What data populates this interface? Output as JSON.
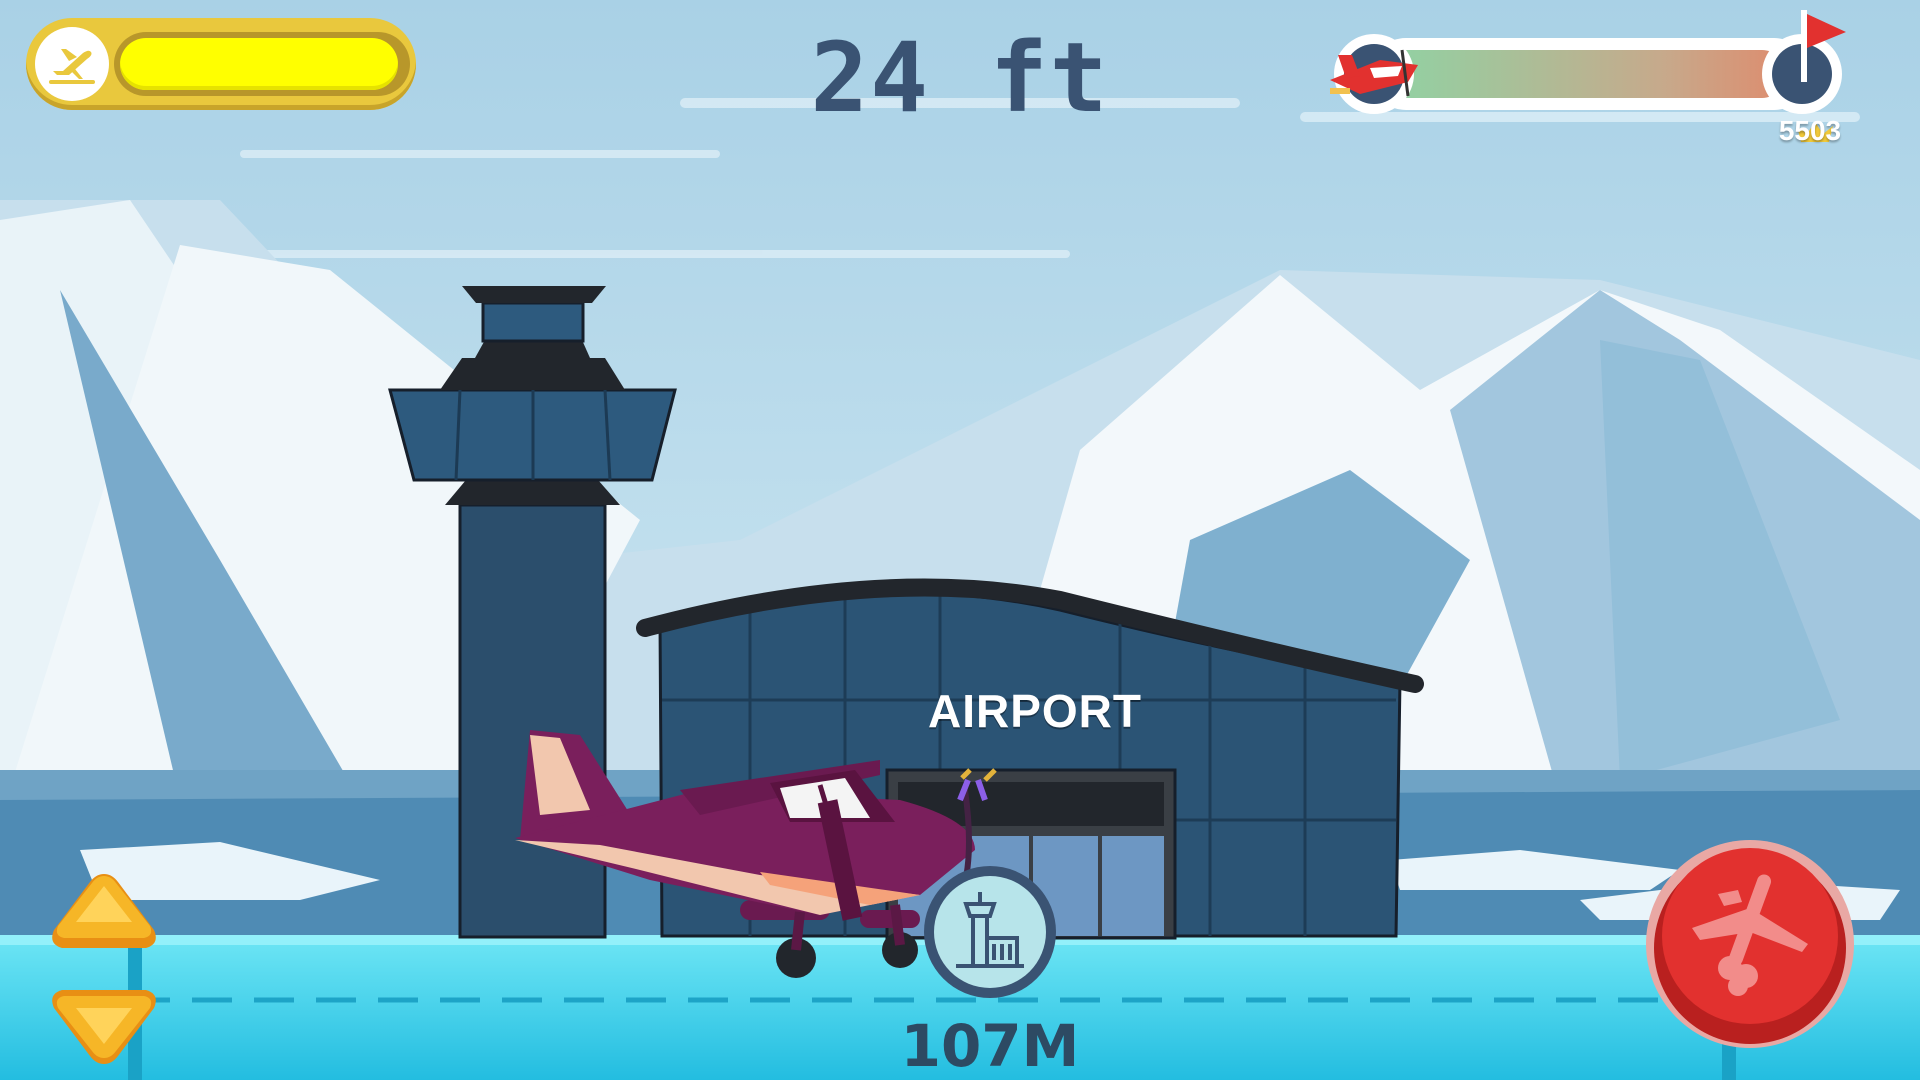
{
  "hud": {
    "fuel_icon": "plane-takeoff-icon",
    "fuel_level": 0.98,
    "altitude": "24 ft",
    "progress_fraction": 0.0,
    "best_score": "5503",
    "best_icon": "crown-icon",
    "goal_icon": "flag-icon"
  },
  "scene": {
    "building_label": "AIRPORT",
    "distance": "107M",
    "distance_icon": "airport-tower-icon"
  },
  "controls": {
    "up_icon": "arrow-up-icon",
    "down_icon": "arrow-down-icon",
    "action_icon": "plane-boost-icon"
  },
  "colors": {
    "sky": "#bcdcec",
    "fuel_fill": "#ffff00",
    "fuel_frame": "#e9c83d",
    "plane": "#7a1f5c",
    "runway": "#2ec4e6",
    "action_button": "#e2312f",
    "text_dark": "#3a5373"
  }
}
